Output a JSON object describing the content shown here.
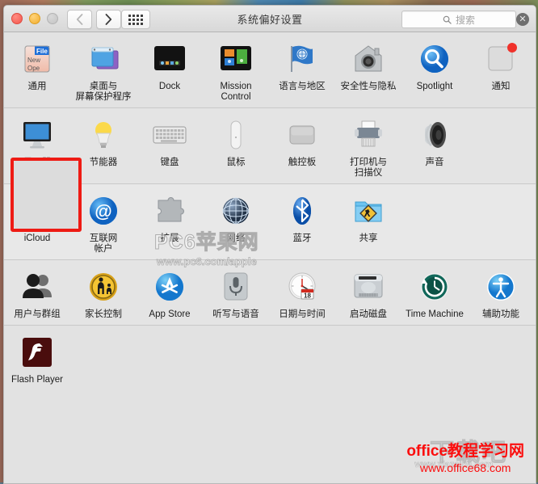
{
  "window": {
    "title": "系统偏好设置",
    "traffic_lights": [
      "close",
      "minimize",
      "zoom"
    ]
  },
  "toolbar": {
    "back_label": "‹",
    "forward_label": "›",
    "grid_label": "show-all-grid",
    "search": {
      "placeholder": "搜索",
      "value": "",
      "clear_label": "✕"
    }
  },
  "selection": {
    "highlighted_item": "显示器",
    "annotation_color": "#ee1b14"
  },
  "rows": [
    {
      "items": [
        {
          "label": "通用",
          "icon": "general-icon"
        },
        {
          "label": "桌面与\n屏幕保护程序",
          "icon": "desktop-screensaver-icon"
        },
        {
          "label": "Dock",
          "icon": "dock-icon"
        },
        {
          "label": "Mission\nControl",
          "icon": "mission-control-icon"
        },
        {
          "label": "语言与地区",
          "icon": "language-region-icon"
        },
        {
          "label": "安全性与隐私",
          "icon": "security-privacy-icon"
        },
        {
          "label": "Spotlight",
          "icon": "spotlight-icon"
        },
        {
          "label": "通知",
          "icon": "notifications-icon"
        }
      ]
    },
    {
      "items": [
        {
          "label": "显示器",
          "icon": "displays-icon"
        },
        {
          "label": "节能器",
          "icon": "energy-saver-icon"
        },
        {
          "label": "键盘",
          "icon": "keyboard-icon"
        },
        {
          "label": "鼠标",
          "icon": "mouse-icon"
        },
        {
          "label": "触控板",
          "icon": "trackpad-icon"
        },
        {
          "label": "打印机与\n扫描仪",
          "icon": "printers-scanners-icon"
        },
        {
          "label": "声音",
          "icon": "sound-icon"
        }
      ]
    },
    {
      "items": [
        {
          "label": "iCloud",
          "icon": "icloud-icon"
        },
        {
          "label": "互联网\n帐户",
          "icon": "internet-accounts-icon"
        },
        {
          "label": "扩展",
          "icon": "extensions-icon"
        },
        {
          "label": "网络",
          "icon": "network-icon"
        },
        {
          "label": "蓝牙",
          "icon": "bluetooth-icon"
        },
        {
          "label": "共享",
          "icon": "sharing-icon"
        }
      ]
    },
    {
      "items": [
        {
          "label": "用户与群组",
          "icon": "users-groups-icon"
        },
        {
          "label": "家长控制",
          "icon": "parental-controls-icon"
        },
        {
          "label": "App Store",
          "icon": "app-store-icon"
        },
        {
          "label": "听写与语音",
          "icon": "dictation-speech-icon"
        },
        {
          "label": "日期与时间",
          "icon": "date-time-icon"
        },
        {
          "label": "启动磁盘",
          "icon": "startup-disk-icon"
        },
        {
          "label": "Time Machine",
          "icon": "time-machine-icon"
        },
        {
          "label": "辅助功能",
          "icon": "accessibility-icon"
        }
      ]
    },
    {
      "items": [
        {
          "label": "Flash Player",
          "icon": "flash-player-icon"
        }
      ]
    }
  ],
  "watermarks": {
    "center": {
      "line1": "PC6苹果网",
      "line2": "www.pc6.com/apple"
    },
    "bottom_right": {
      "ghost1": "下载吧",
      "ghost2": "www.xiazaiba.com",
      "red1": "office教程学习网",
      "red2": "www.office68.com"
    }
  }
}
